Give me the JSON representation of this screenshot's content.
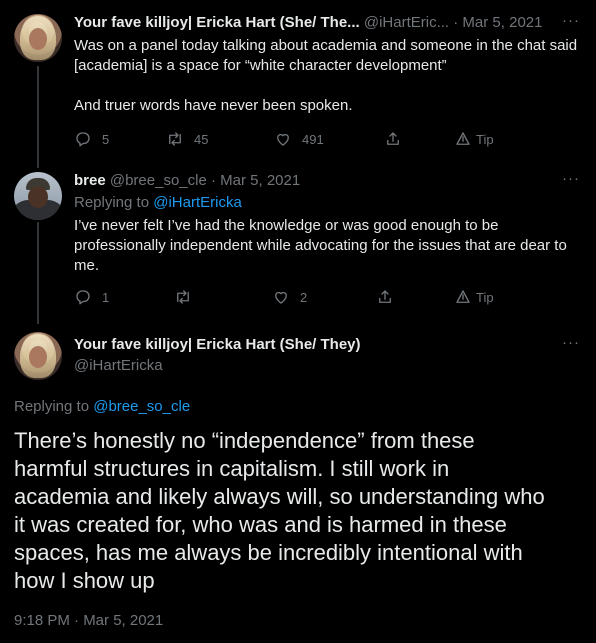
{
  "tweet1": {
    "name": "Your fave killjoy| Ericka Hart (She/ The...",
    "handle": "@iHartEric...",
    "date": "· Mar 5, 2021",
    "text_line1": "Was on a panel today talking about academia and someone in the chat said",
    "text_line2": "[academia] is a space for “white character development”",
    "text_line3": "And truer words have never been spoken.",
    "replies": "5",
    "retweets": "45",
    "likes": "491",
    "tip": "Tip"
  },
  "tweet2": {
    "name": "bree",
    "handle": "@bree_so_cle",
    "date": "· Mar 5, 2021",
    "replying_prefix": "Replying to",
    "replying_to": "@iHartEricka",
    "text_line1": "I’ve never felt I’ve had the knowledge or was good enough to be",
    "text_line2": "professionally independent while advocating for the issues that are dear to",
    "text_line3": "me.",
    "replies": "1",
    "retweets": "",
    "likes": "2",
    "tip": "Tip"
  },
  "main": {
    "name": "Your fave killjoy| Ericka Hart (She/ They)",
    "handle": "@iHartEricka",
    "replying_prefix": "Replying to",
    "replying_to": "@bree_so_cle",
    "text_lines": [
      "There’s honestly no “independence” from these",
      "harmful structures in capitalism. I still work in",
      "academia and likely always will, so understanding who",
      "it was created for, who was and is harmed in these",
      "spaces, has me always be incredibly intentional with",
      "how I show up"
    ],
    "timestamp": "9:18 PM · Mar 5, 2021"
  },
  "more_label": "···",
  "colors": {
    "background": "#000000",
    "text": "#e7e9ea",
    "muted": "#71767b",
    "link": "#1d9bf0",
    "thread_line": "#333639"
  }
}
